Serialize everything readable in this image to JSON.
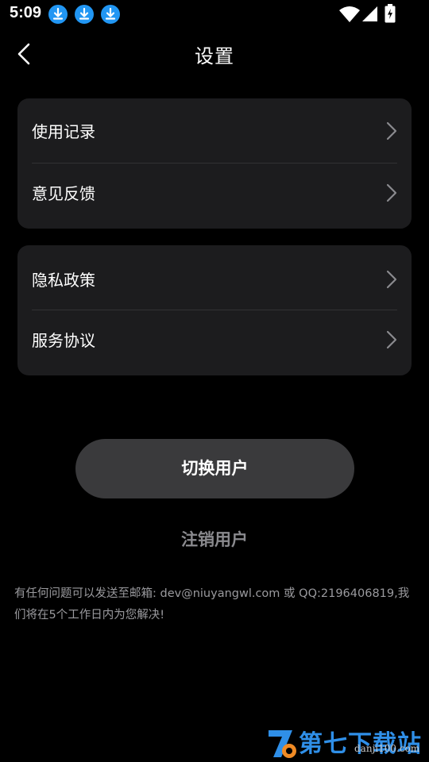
{
  "status_bar": {
    "time": "5:09",
    "notification_icons": [
      "download-icon",
      "download-icon",
      "download-icon"
    ],
    "system_icons": [
      "wifi-icon",
      "signal-icon",
      "battery-charging-icon"
    ]
  },
  "header": {
    "back_icon": "chevron-left-icon",
    "title": "设置"
  },
  "settings_groups": [
    {
      "items": [
        {
          "label": "使用记录"
        },
        {
          "label": "意见反馈"
        }
      ]
    },
    {
      "items": [
        {
          "label": "隐私政策"
        },
        {
          "label": "服务协议"
        }
      ]
    }
  ],
  "actions": {
    "switch_user": "切换用户",
    "logout": "注销用户"
  },
  "contact_note": "有任何问题可以发送至邮箱: dev@niuyangwl.com 或 QQ:2196406819,我们将在5个工作日内为您解决!",
  "watermark": {
    "brand": "第七下载站",
    "url": "danji100.com"
  },
  "colors": {
    "background": "#000000",
    "card": "#1c1c1e",
    "button": "#3a3a3c",
    "secondary_text": "#8a8a8e",
    "download_badge": "#2196f3",
    "watermark_blue": "#2f8fe8"
  }
}
